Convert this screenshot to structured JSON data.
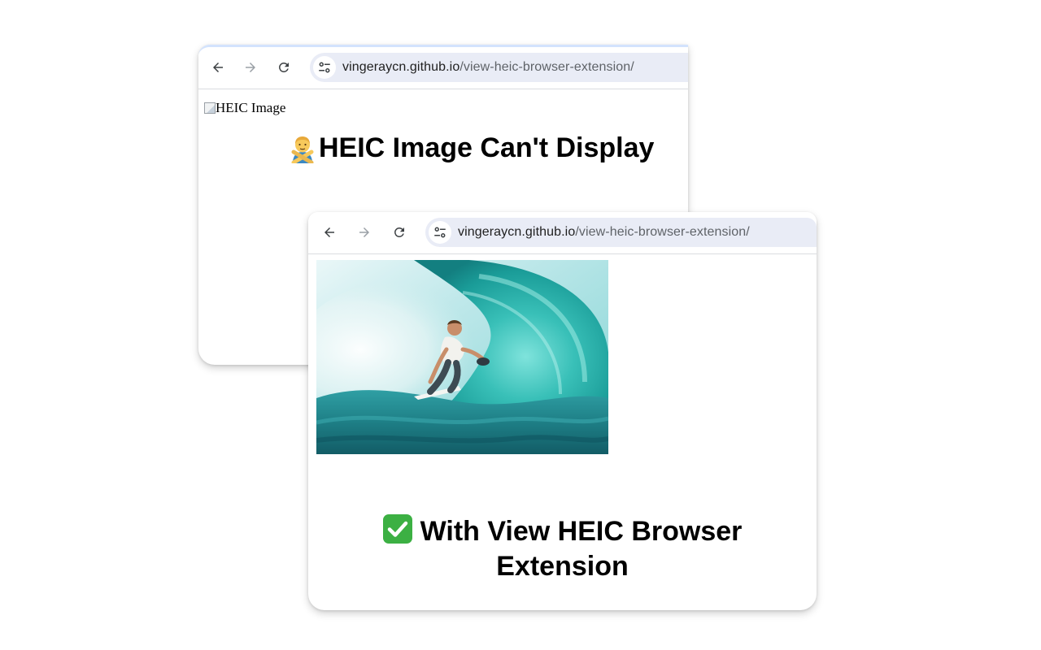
{
  "back_window": {
    "url_host": "vingeraycn.github.io",
    "url_path": "/view-heic-browser-extension/",
    "broken_image_alt": "HEIC Image",
    "heading": "HEIC Image Can't Display"
  },
  "front_window": {
    "url_host": "vingeraycn.github.io",
    "url_path": "/view-heic-browser-extension/",
    "heading": "With View HEIC Browser Extension"
  },
  "icons": {
    "back": "arrow-left-icon",
    "forward": "arrow-right-icon",
    "reload": "reload-icon",
    "site_info": "tune-icon",
    "person_gesturing_no": "person-gesturing-no-emoji",
    "check_mark": "check-mark-button-emoji"
  },
  "colors": {
    "omnibox": "#e9ecf6",
    "check_green": "#3cb043",
    "url_path": "#5f6368"
  }
}
